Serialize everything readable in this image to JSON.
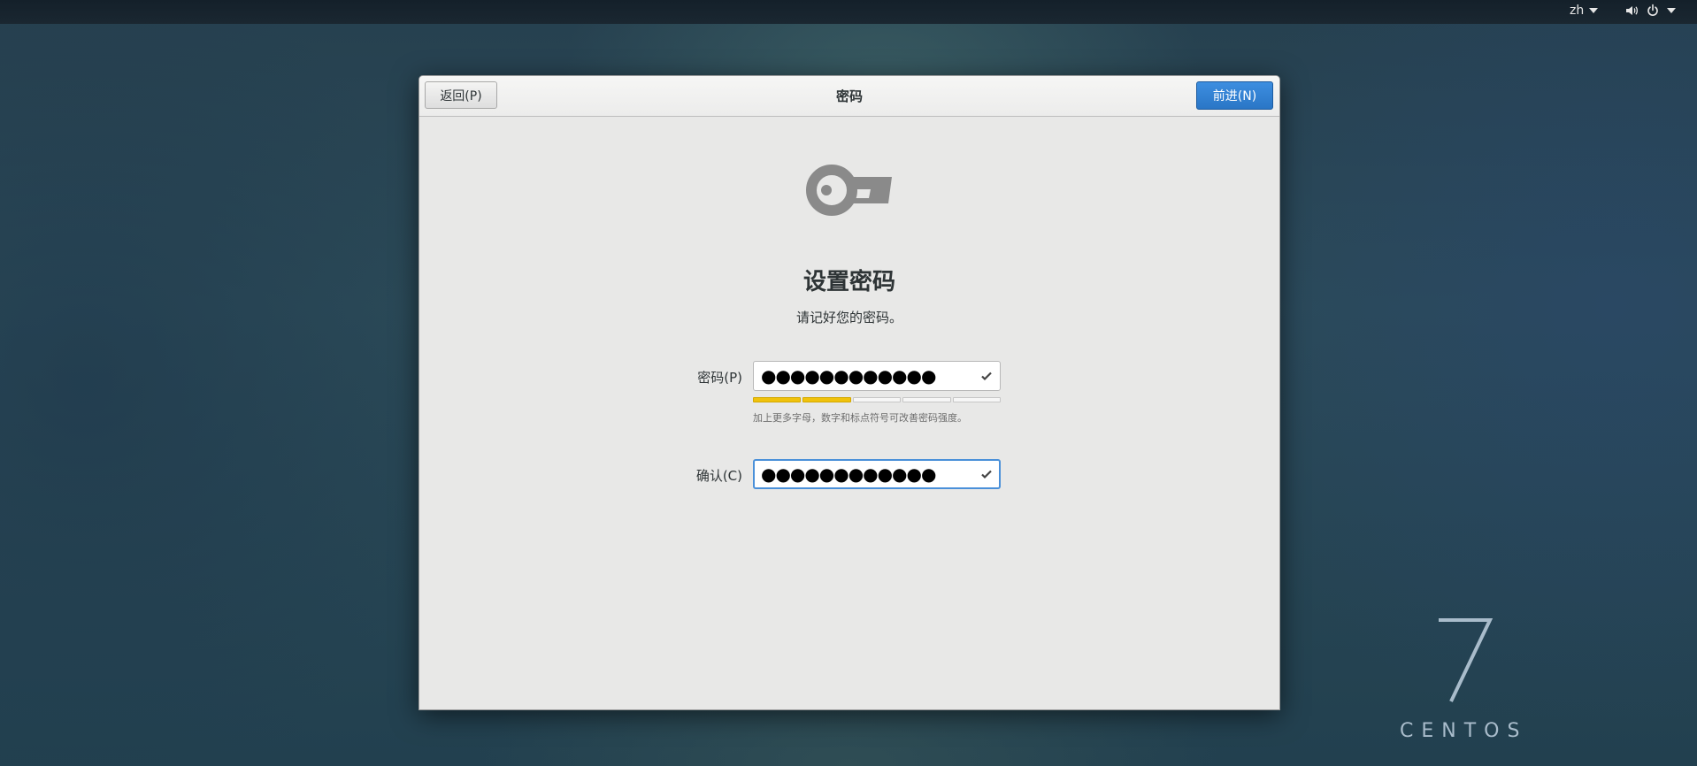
{
  "topbar": {
    "language": "zh",
    "icons": [
      "volume-icon",
      "power-icon",
      "chevron-down-icon"
    ]
  },
  "dialog": {
    "back_label": "返回(P)",
    "title": "密码",
    "next_label": "前进(N)",
    "key_icon": "key-icon",
    "heading": "设置密码",
    "subheading": "请记好您的密码。",
    "password": {
      "label": "密码(P)",
      "value": "●●●●●●●●●●●●",
      "status_icon": "check-icon"
    },
    "strength": {
      "level": 0.4,
      "hint": "加上更多字母，数字和标点符号可改善密码强度。"
    },
    "confirm": {
      "label": "确认(C)",
      "value": "●●●●●●●●●●●●",
      "status_icon": "check-icon"
    }
  },
  "brand": {
    "version": "7",
    "name": "CENTOS"
  },
  "colors": {
    "accent": "#2a76c6",
    "strength": "#f0c20c",
    "dialog_bg": "#e8e8e7"
  }
}
